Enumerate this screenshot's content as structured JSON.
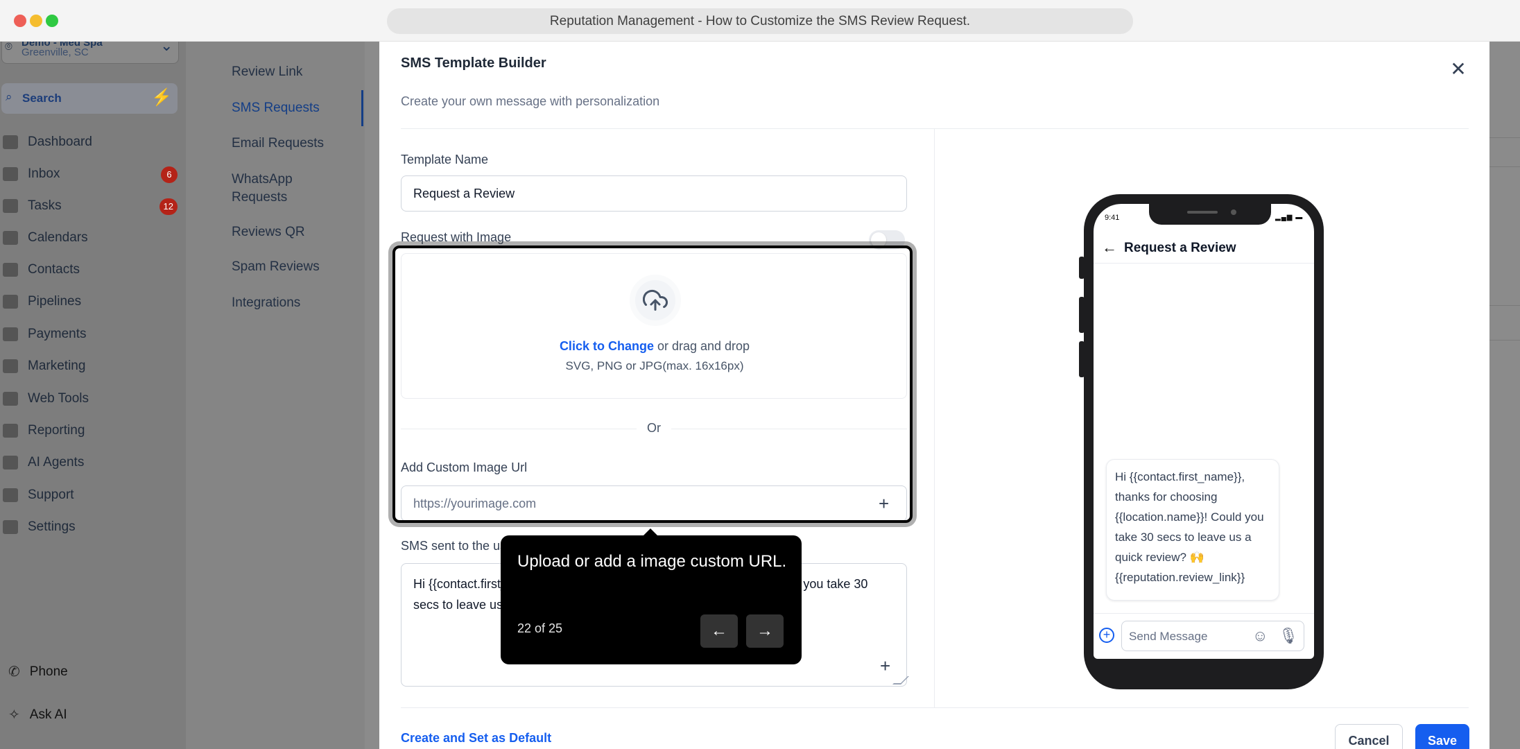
{
  "window": {
    "title": "Reputation Management - How to Customize the SMS Review Request."
  },
  "location": {
    "name": "Demo - Med Spa",
    "city": "Greenville, SC"
  },
  "sidebar": {
    "search_label": "Search",
    "items": [
      {
        "label": "Dashboard",
        "badge": ""
      },
      {
        "label": "Inbox",
        "badge": "6"
      },
      {
        "label": "Tasks",
        "badge": "12"
      },
      {
        "label": "Calendars",
        "badge": ""
      },
      {
        "label": "Contacts",
        "badge": ""
      },
      {
        "label": "Pipelines",
        "badge": ""
      },
      {
        "label": "Payments",
        "badge": ""
      },
      {
        "label": "Marketing",
        "badge": ""
      },
      {
        "label": "Web Tools",
        "badge": ""
      },
      {
        "label": "Reporting",
        "badge": ""
      },
      {
        "label": "AI Agents",
        "badge": ""
      },
      {
        "label": "Support",
        "badge": ""
      },
      {
        "label": "Settings",
        "badge": ""
      }
    ],
    "phone_label": "Phone",
    "ask_ai_label": "Ask AI"
  },
  "subnav": {
    "items": [
      {
        "label": "Review Link"
      },
      {
        "label": "SMS Requests"
      },
      {
        "label": "Email Requests"
      },
      {
        "label": "WhatsApp Requests"
      },
      {
        "label": "Reviews QR"
      },
      {
        "label": "Spam Reviews"
      },
      {
        "label": "Integrations"
      }
    ]
  },
  "modal": {
    "title": "SMS Template Builder",
    "subtitle": "Create your own message with personalization",
    "template_name_label": "Template Name",
    "template_name_value": "Request a Review",
    "request_with_image_label": "Request with Image",
    "request_with_image_on": false,
    "upload": {
      "link": "Click to Change",
      "text": " or drag and drop",
      "hint": "SVG, PNG or JPG(max. 16x16px)"
    },
    "or_label": "Or",
    "custom_url_label": "Add Custom Image Url",
    "custom_url_placeholder": "https://yourimage.com",
    "sms_label": "SMS sent to the user",
    "sms_text": "Hi {{contact.first_name}}, thanks for choosing {{location.name}}! Could you take 30 secs to leave us a quick review? 🙌 {{reputation.review_link}}",
    "create_default_label": "Create and Set as Default",
    "cancel_label": "Cancel",
    "save_label": "Save"
  },
  "phone_preview": {
    "time": "9:41",
    "title": "Request a Review",
    "message": "Hi {{contact.first_name}}, thanks for choosing {{location.name}}! Could you take 30 secs to leave us a quick review? 🙌",
    "link": "{{reputation.review_link}}",
    "input_placeholder": "Send Message"
  },
  "tooltip": {
    "text": "Upload or add a image custom URL.",
    "step": "22 of 25"
  },
  "icons": {
    "close": "close-icon",
    "upload": "upload-cloud-icon",
    "plus": "plus-icon",
    "prev": "arrow-left-icon",
    "next": "arrow-right-icon"
  },
  "colors": {
    "primary": "#155eef",
    "badge": "#b42318",
    "tooltip_bg": "#000000"
  }
}
